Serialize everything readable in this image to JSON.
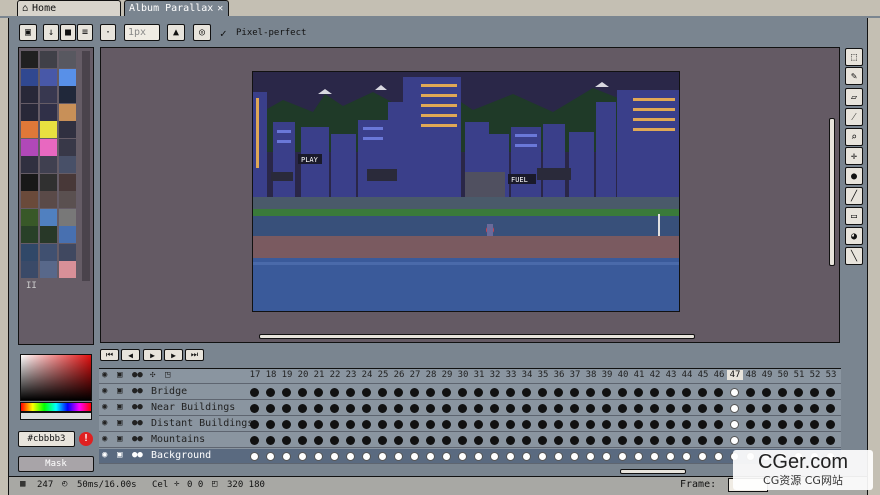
{
  "tabs": [
    {
      "label": "Home",
      "icon": "home-icon"
    },
    {
      "label": "Album Parallax",
      "icon": "close-icon"
    }
  ],
  "toolbar": {
    "brush_size": "1px",
    "pixel_perfect_label": "Pixel-perfect",
    "pixel_perfect_checked": true
  },
  "palette": {
    "colors": [
      "#202020",
      "#404048",
      "#585860",
      "#304890",
      "#4858a8",
      "#5890e8",
      "#282838",
      "#383850",
      "#20283a",
      "#282838",
      "#303048",
      "#c89058",
      "#e07838",
      "#e8e040",
      "#303040",
      "#b048b8",
      "#e868c0",
      "#383848",
      "#303040",
      "#404050",
      "#485068",
      "#181818",
      "#303030",
      "#483838",
      "#6a4a3a",
      "#5a4a48",
      "#5a5050",
      "#385828",
      "#5080c0",
      "#787878",
      "#284028",
      "#283828",
      "#4870b0",
      "#304868",
      "#405070",
      "#404860",
      "#3a4a68",
      "#58688a",
      "#d89098"
    ],
    "page_label": "II"
  },
  "color_picker": {
    "hex": "#cbbbb3",
    "warning_icon": "warning-icon"
  },
  "mask_button": {
    "label": "Mask"
  },
  "playback": {
    "buttons": [
      "first-frame",
      "prev-frame",
      "play",
      "next-frame",
      "last-frame"
    ]
  },
  "timeline": {
    "frames": [
      17,
      18,
      19,
      20,
      21,
      22,
      23,
      24,
      25,
      26,
      27,
      28,
      29,
      30,
      31,
      32,
      33,
      34,
      35,
      36,
      37,
      38,
      39,
      40,
      41,
      42,
      43,
      44,
      45,
      46,
      47,
      48,
      49,
      50,
      51,
      52,
      53
    ],
    "current_frame": 47,
    "layers": [
      {
        "name": "Bridge",
        "selected": false
      },
      {
        "name": "Near Buildings",
        "selected": false
      },
      {
        "name": "Distant Buildings",
        "selected": false
      },
      {
        "name": "Mountains",
        "selected": false
      },
      {
        "name": "Background",
        "selected": true
      }
    ]
  },
  "status": {
    "frames_count": "247",
    "duration": "50ms/16.00s",
    "cel_label": "Cel",
    "coords": "0 0",
    "size": "320 180",
    "frame_label": "Frame:"
  },
  "watermark": {
    "title": "CGer.com",
    "subtitle": "CG资源 CG网站"
  },
  "colors": {
    "bg": "#c4bfb3",
    "panel": "#7a8590",
    "canvas_bg": "#645a64",
    "accent_selected": "#8a9aa8"
  }
}
